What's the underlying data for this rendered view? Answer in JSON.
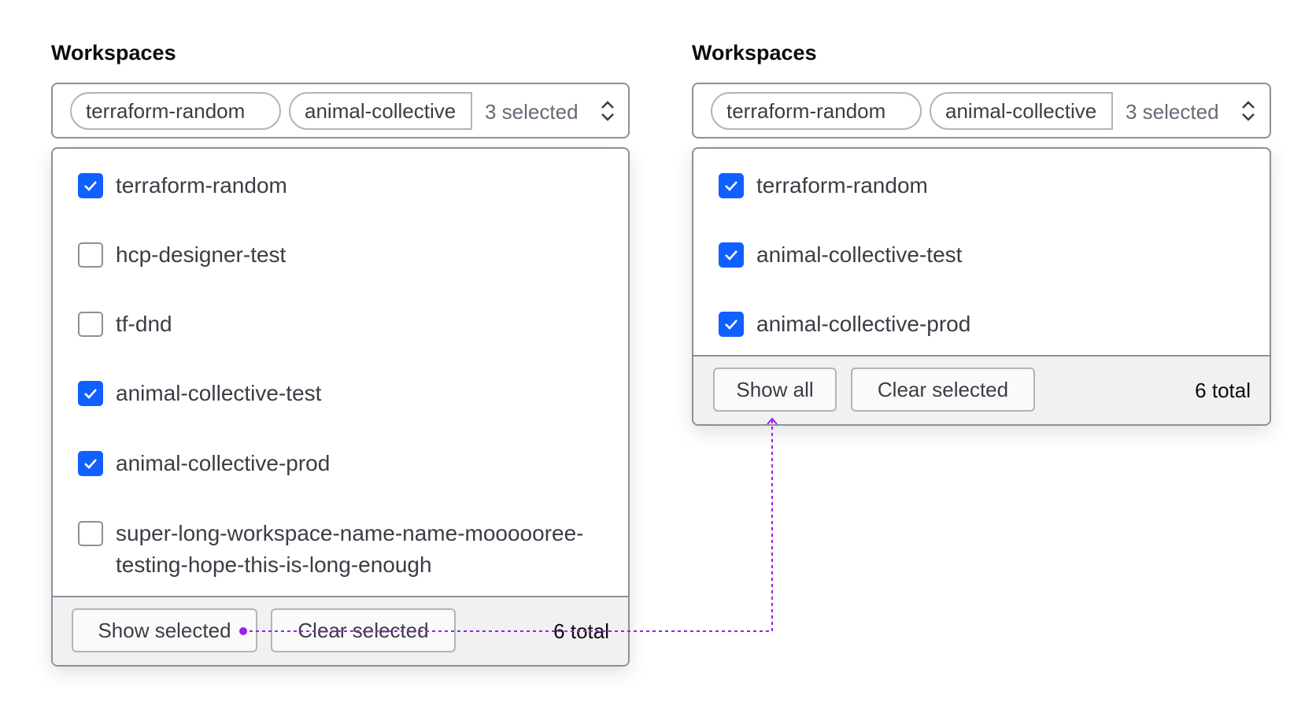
{
  "left": {
    "title": "Workspaces",
    "chips": [
      "terraform-random",
      "animal-collective"
    ],
    "count": "3 selected",
    "options": [
      {
        "label": "terraform-random",
        "checked": true
      },
      {
        "label": "hcp-designer-test",
        "checked": false
      },
      {
        "label": "tf-dnd",
        "checked": false
      },
      {
        "label": "animal-collective-test",
        "checked": true
      },
      {
        "label": "animal-collective-prod",
        "checked": true
      },
      {
        "label": "super-long-workspace-name-name-moooooree-testing-hope-this-is-long-enough",
        "checked": false
      }
    ],
    "show_button": "Show selected",
    "clear_button": "Clear selected",
    "total": "6 total"
  },
  "right": {
    "title": "Workspaces",
    "chips": [
      "terraform-random",
      "animal-collective"
    ],
    "count": "3 selected",
    "options": [
      {
        "label": "terraform-random",
        "checked": true
      },
      {
        "label": "animal-collective-test",
        "checked": true
      },
      {
        "label": "animal-collective-prod",
        "checked": true
      }
    ],
    "show_button": "Show all",
    "clear_button": "Clear selected",
    "total": "6 total"
  },
  "colors": {
    "accent": "#1060ff",
    "connector": "#9a1df0"
  }
}
